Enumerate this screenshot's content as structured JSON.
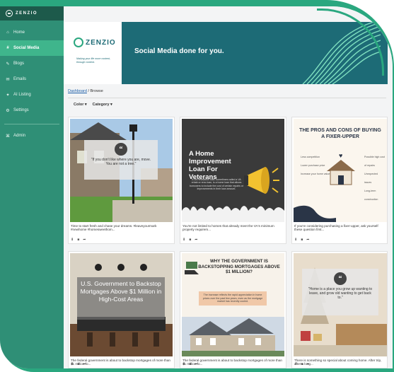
{
  "brand": {
    "name": "ZENZIO",
    "tagline": "Making your life more content, through content."
  },
  "sidebar": {
    "items": [
      {
        "label": "Home",
        "icon": "home-icon",
        "glyph": "⌂"
      },
      {
        "label": "Social Media",
        "icon": "hashtag-icon",
        "glyph": "#"
      },
      {
        "label": "Blogs",
        "icon": "blog-icon",
        "glyph": "✎"
      },
      {
        "label": "Emails",
        "icon": "mail-icon",
        "glyph": "✉"
      },
      {
        "label": "AI Listing",
        "icon": "ai-icon",
        "glyph": "✦"
      },
      {
        "label": "Settings",
        "icon": "gear-icon",
        "glyph": "⚙"
      }
    ],
    "admin": {
      "label": "Admin",
      "icon": "admin-icon",
      "glyph": "⌘"
    }
  },
  "banner": {
    "title": "Social Media done for you."
  },
  "breadcrumb": {
    "link": "Dashboard",
    "sep": " / ",
    "current": "Browse"
  },
  "filters": {
    "color": "Color",
    "category": "Category",
    "caret": "▾"
  },
  "colors": {
    "brand_green": "#2aa77f",
    "sidebar": "#2f8f76",
    "active": "#3fb58c",
    "banner": "#1d6b76"
  },
  "cards": [
    {
      "overlay": "\"If you don't like where you are, move. You are not a tree.\"",
      "caption": "Time to start fresh and chase your dreams. #leaveyourmark #newhome #homesweethom...",
      "quote_glyph": "“"
    },
    {
      "title": "A Home Improvement Loan For Veterans",
      "body": "A VA renovation loan, sometimes called a VA rehab or reno loan, is a home loan that allows borrowers to include the cost of certain repairs or improvements in their loan amount.",
      "caption": "You're not limited to homes that already meet the VA's minimum property requirem..."
    },
    {
      "title": "THE PROS AND CONS OF BUYING A FIXER-UPPER",
      "labels_left": [
        "Less competition",
        "Lower purchase price",
        "Increase your home value"
      ],
      "labels_right": [
        "Possible high cost of repairs",
        "Unexpected issues",
        "Long-term construction"
      ],
      "caption": "If you're considering purchasing a fixer-upper, ask yourself these question first..."
    },
    {
      "title": "U.S. Government to Backstop Mortgages Above $1 Million in High-Cost Areas",
      "caption": "The federal government is about to backstop mortgages of more than $1 million fo..."
    },
    {
      "title": "WHY THE GOVERNMENT IS BACKSTOPPING MORTGAGES ABOVE $1 MILLION?",
      "body": "The increase reflects the rapid appreciation in home prices over the past few years, even as the mortgage market has recently cooled.",
      "caption": "The federal government is about to backstop mortgages of more than $1 million fo..."
    },
    {
      "overlay": "\"Home is a place you grow up wanting to leave, and grow old wanting to get back to.\"",
      "caption": "There is something so special about coming home. After trip, after a long...",
      "quote_glyph": "“"
    }
  ],
  "actions": {
    "download": "⬇",
    "copy": "■",
    "share": "➦"
  }
}
